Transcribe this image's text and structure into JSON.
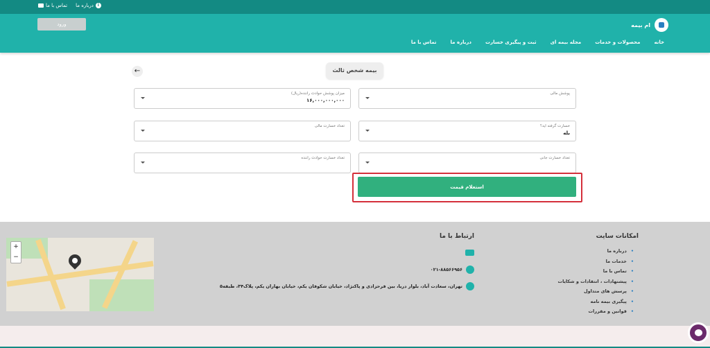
{
  "topbar": {
    "about": "درباره ما",
    "contact": "تماس با ما"
  },
  "header": {
    "login_label": "ورود",
    "brand_name": "ام بیمه",
    "nav": [
      "خانه",
      "محصولات و خدمات",
      "مجله بیمه ای",
      "ثبت و پیگیری خسارت",
      "درباره ما",
      "تماس با ما"
    ]
  },
  "form": {
    "title": "بیمه شخص ثالث",
    "fields": {
      "financial_coverage": {
        "label": "پوشش مالی",
        "value": ""
      },
      "driver_coverage": {
        "label": "میزان پوشش حوادث راننده(ریال)",
        "value": "۱۶,۰۰۰,۰۰۰,۰۰۰"
      },
      "had_claim": {
        "label": "خسارت گرفته اید؟",
        "value": "بله"
      },
      "financial_claims": {
        "label": "تعداد خسارت مالی",
        "value": ""
      },
      "bodily_claims": {
        "label": "تعداد خسارت جانی",
        "value": ""
      },
      "driver_claims": {
        "label": "تعداد خسارت حوادث راننده",
        "value": ""
      }
    },
    "submit_label": "استعلام قیمت"
  },
  "footer": {
    "site_title": "امکانات سایت",
    "site_links": [
      "درباره ما",
      "خدمات ما",
      "تماس با ما",
      "پیشنهادات ، انتقادات و شکایات",
      "پرسش های متداول",
      "پیگیری بیمه نامه",
      "قوانین و مقررات"
    ],
    "contact_title": "ارتباط با ما",
    "phone": "۰۲۱-۸۸۵۶۶۹۵۶",
    "address": "تهران، سعادت آباد، بلوار دریا، بین فرحزادی و پاکنژاد، خیابان شکوفان یکم، خیابان بهاران یکم، پلاک۳۴، طبقه۵",
    "map_zoom": [
      "+",
      "−"
    ]
  },
  "colors": {
    "topbar": "#138a83",
    "header": "#20b2aa",
    "cta": "#31b07e",
    "highlight": "#d42f3a"
  }
}
